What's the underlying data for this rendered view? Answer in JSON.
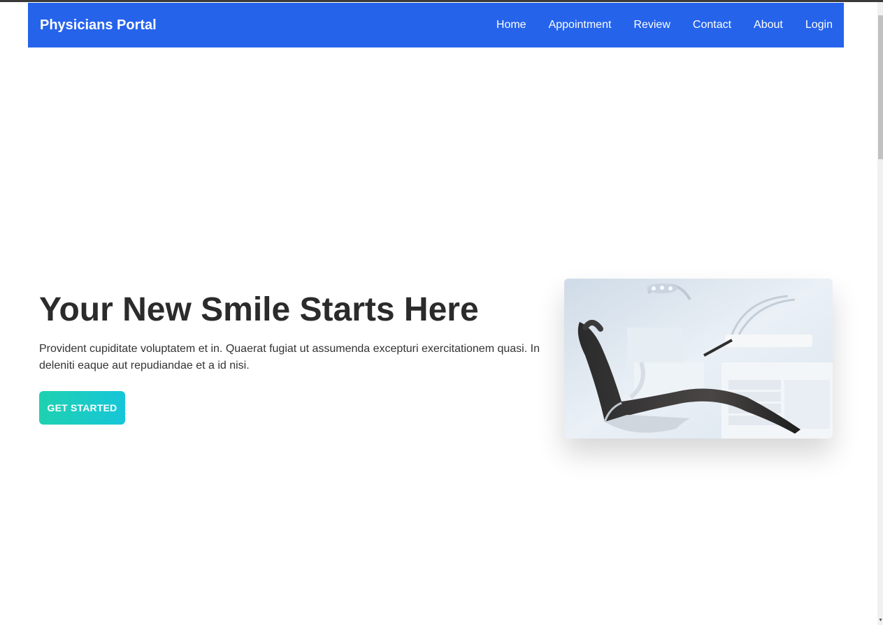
{
  "nav": {
    "brand": "Physicians Portal",
    "links": [
      "Home",
      "Appointment",
      "Review",
      "Contact",
      "About",
      "Login"
    ]
  },
  "hero": {
    "title": "Your New Smile Starts Here",
    "description": "Provident cupiditate voluptatem et in. Quaerat fugiat ut assumenda excepturi exercitationem quasi. In deleniti eaque aut repudiandae et a id nisi.",
    "cta_label": "GET STARTED",
    "image_subject": "dental-chair-photo"
  },
  "colors": {
    "nav_background": "#2563eb",
    "cta_gradient_start": "#1fd1b0",
    "cta_gradient_end": "#16c6d9",
    "title_text": "#2b2b2b"
  }
}
